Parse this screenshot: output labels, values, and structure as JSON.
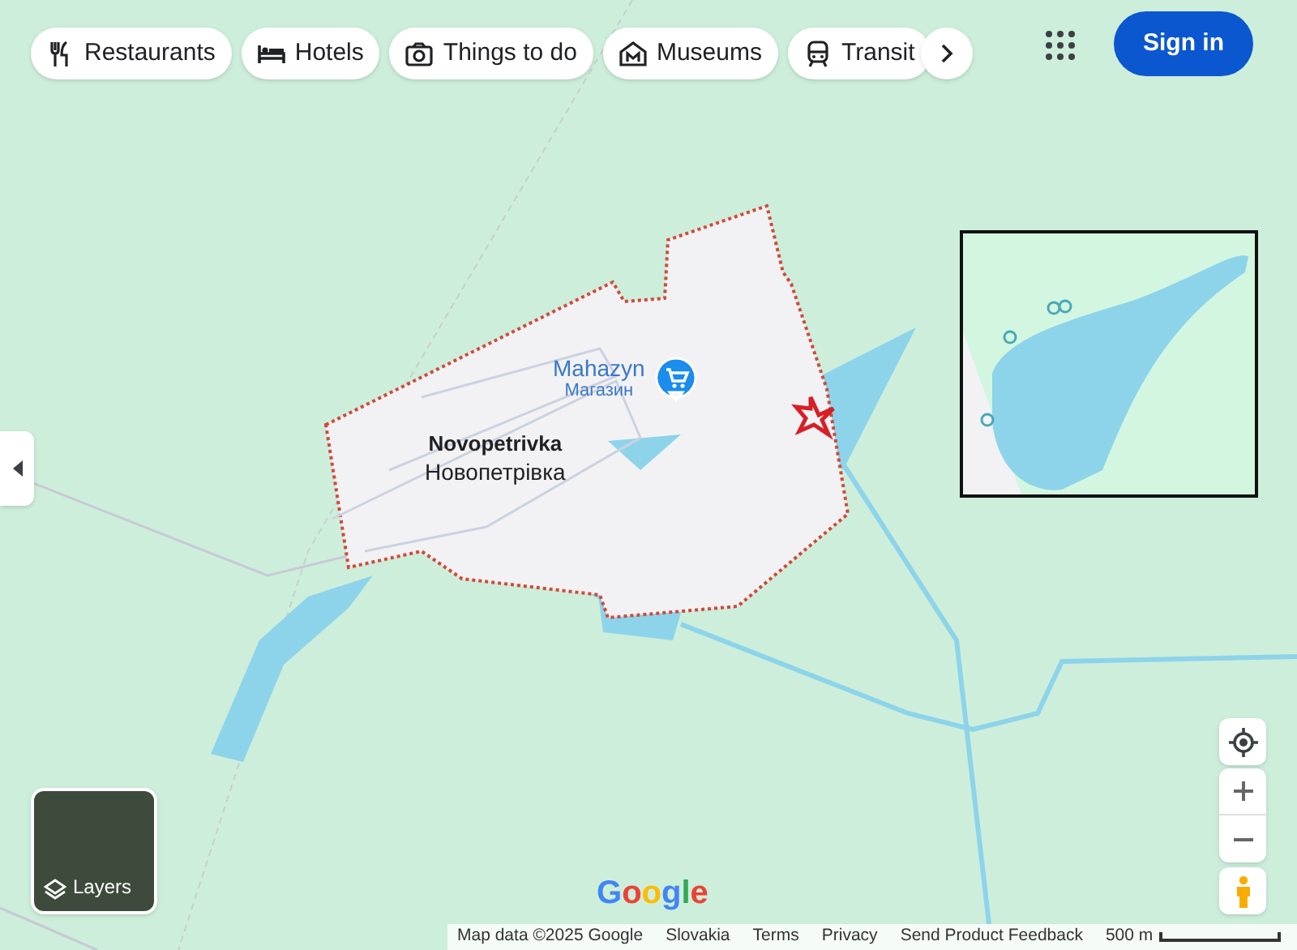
{
  "chips": [
    {
      "label": "Restaurants",
      "kind": "restaurants"
    },
    {
      "label": "Hotels",
      "kind": "hotels"
    },
    {
      "label": "Things to do",
      "kind": "things"
    },
    {
      "label": "Museums",
      "kind": "museums"
    },
    {
      "label": "Transit",
      "kind": "transit"
    }
  ],
  "sign_in": "Sign in",
  "poi": {
    "name": "Mahazyn",
    "local_name": "Магазин"
  },
  "place": {
    "name": "Novopetrivka",
    "local_name": "Новопетрівка"
  },
  "layers": "Layers",
  "logo": "Google",
  "footer": [
    "Map data ©2025 Google",
    "Slovakia",
    "Terms",
    "Privacy",
    "Send Product Feedback"
  ],
  "scale": "500 m"
}
